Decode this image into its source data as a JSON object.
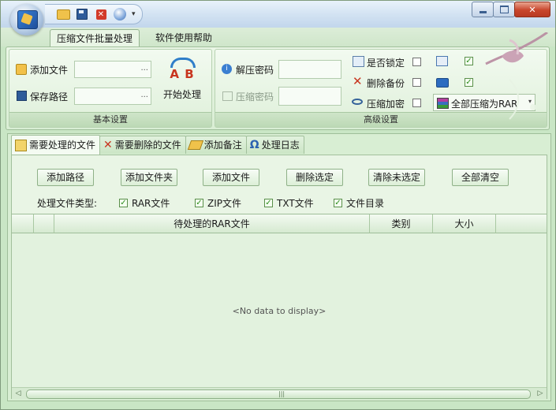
{
  "ribbon": {
    "tabs": [
      "压缩文件批量处理",
      "软件使用帮助"
    ],
    "basic_group": {
      "caption": "基本设置",
      "add_file_label": "添加文件",
      "save_path_label": "保存路径",
      "ellipsis": "...",
      "start_label": "开始处理",
      "start_icon_text": "A B"
    },
    "advanced_group": {
      "caption": "高级设置",
      "extract_password_label": "解压密码",
      "compress_password_label": "压缩密码",
      "lock_label": "是否锁定",
      "delete_backup_label": "删除备份",
      "compress_encrypt_label": "压缩加密",
      "compress_all_combo": "全部压缩为RAR"
    }
  },
  "tabs": [
    "需要处理的文件",
    "需要删除的文件",
    "添加备注",
    "处理日志"
  ],
  "actions": [
    "添加路径",
    "添加文件夹",
    "添加文件",
    "删除选定",
    "清除未选定",
    "全部清空"
  ],
  "file_types": {
    "label": "处理文件类型:",
    "items": [
      "RAR文件",
      "ZIP文件",
      "TXT文件",
      "文件目录"
    ]
  },
  "grid": {
    "columns": [
      "待处理的RAR文件",
      "类别",
      "大小"
    ],
    "empty_text": "<No data to display>"
  },
  "scroll_grip": "|||"
}
